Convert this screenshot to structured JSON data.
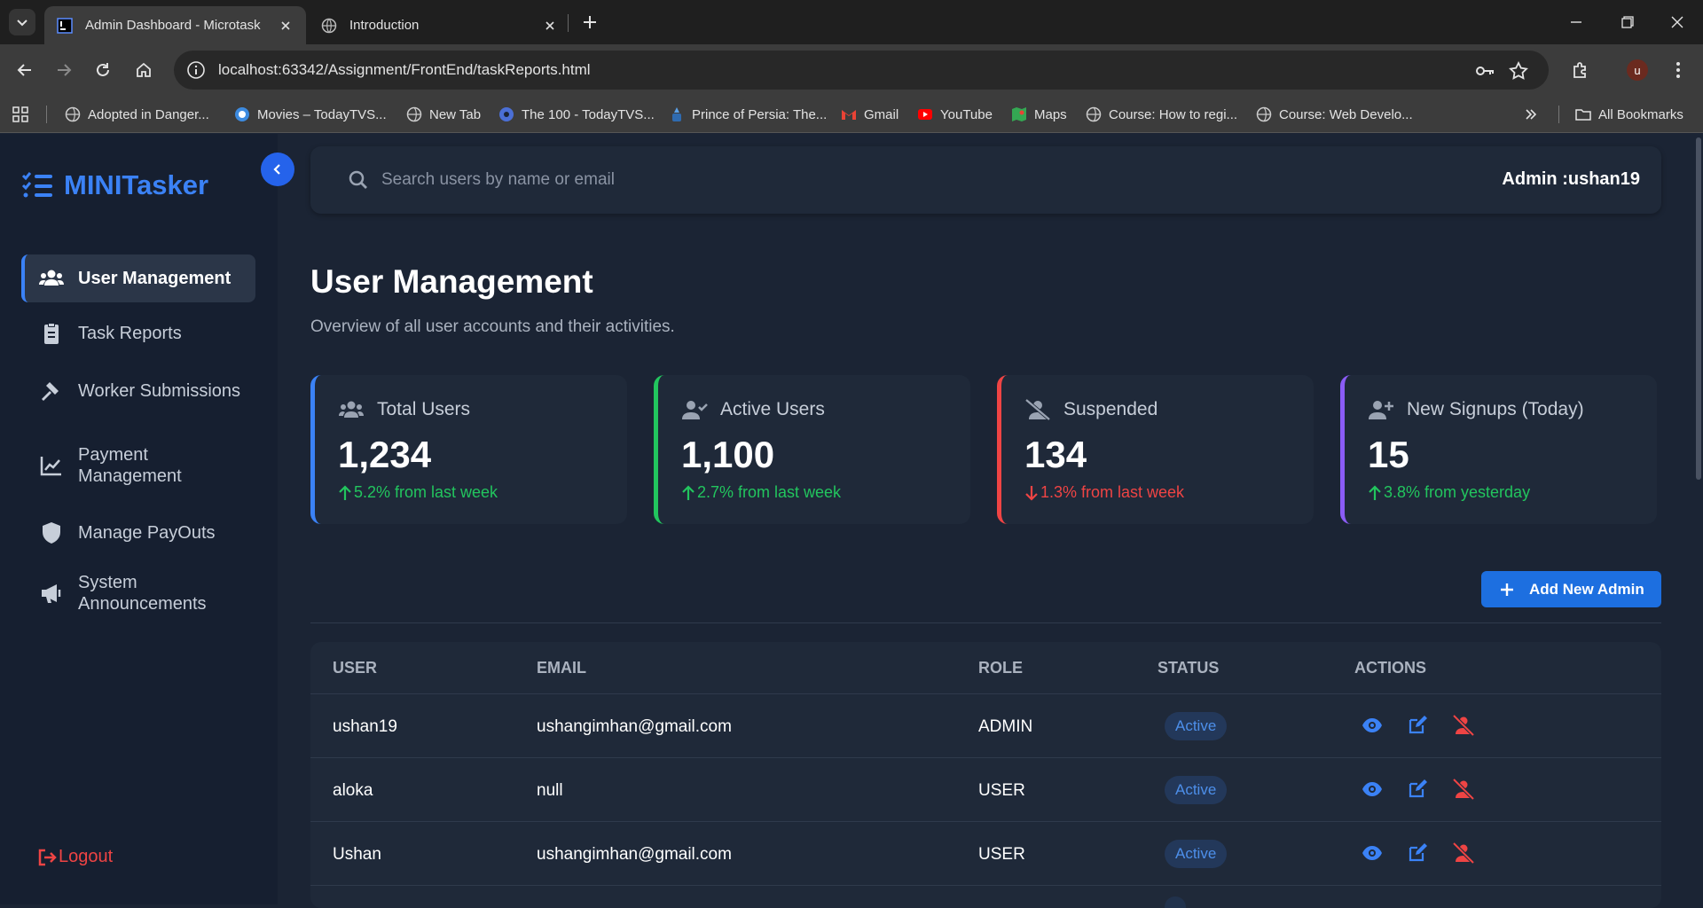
{
  "browser": {
    "tabs": [
      {
        "title": "Admin Dashboard - Microtask",
        "active": true
      },
      {
        "title": "Introduction",
        "active": false
      }
    ],
    "url": "localhost:63342/Assignment/FrontEnd/taskReports.html",
    "bookmarks": [
      "Adopted in Danger...",
      "Movies – TodayTVS...",
      "New Tab",
      "The 100 - TodayTVS...",
      "Prince of Persia: The...",
      "Gmail",
      "YouTube",
      "Maps",
      "Course: How to regi...",
      "Course: Web Develo..."
    ],
    "all_bookmarks": "All Bookmarks",
    "profile_initial": "u"
  },
  "app": {
    "logo": "MINITasker",
    "nav": [
      {
        "label": "User Management",
        "icon": "users-icon",
        "active": true
      },
      {
        "label": "Task Reports",
        "icon": "clipboard-icon",
        "active": false
      },
      {
        "label": "Worker Submissions",
        "icon": "hammer-icon",
        "active": false
      },
      {
        "label": "Payment Management",
        "icon": "chart-line-icon",
        "active": false
      },
      {
        "label": "Manage PayOuts",
        "icon": "shield-icon",
        "active": false
      },
      {
        "label": "System Announcements",
        "icon": "megaphone-icon",
        "active": false
      }
    ],
    "logout": "Logout"
  },
  "header": {
    "search_placeholder": "Search users by name or email",
    "admin_label": "Admin :ushan19"
  },
  "page": {
    "title": "User Management",
    "subtitle": "Overview of all user accounts and their activities."
  },
  "stats": [
    {
      "label": "Total Users",
      "value": "1,234",
      "delta": "5.2% from last week",
      "direction": "up",
      "accent": "#3b82f6",
      "delta_color": "#22c55e"
    },
    {
      "label": "Active Users",
      "value": "1,100",
      "delta": "2.7% from last week",
      "direction": "up",
      "accent": "#22c55e",
      "delta_color": "#22c55e"
    },
    {
      "label": "Suspended",
      "value": "134",
      "delta": "1.3% from last week",
      "direction": "down",
      "accent": "#ef4444",
      "delta_color": "#ef4444"
    },
    {
      "label": "New Signups (Today)",
      "value": "15",
      "delta": "3.8% from yesterday",
      "direction": "up",
      "accent": "#8b5cf6",
      "delta_color": "#22c55e"
    }
  ],
  "add_button": "Add New Admin",
  "table": {
    "columns": [
      "USER",
      "EMAIL",
      "ROLE",
      "STATUS",
      "ACTIONS"
    ],
    "rows": [
      {
        "user": "ushan19",
        "email": "ushangimhan@gmail.com",
        "role": "ADMIN",
        "status": "Active"
      },
      {
        "user": "aloka",
        "email": "null",
        "role": "USER",
        "status": "Active"
      },
      {
        "user": "Ushan",
        "email": "ushangimhan@gmail.com",
        "role": "USER",
        "status": "Active"
      }
    ]
  },
  "colors": {
    "accent": "#3b82f6",
    "sidebar_bg": "#161f30",
    "main_bg": "#1b2434",
    "card_bg": "#1f2939",
    "danger": "#ef4444",
    "success": "#22c55e"
  }
}
